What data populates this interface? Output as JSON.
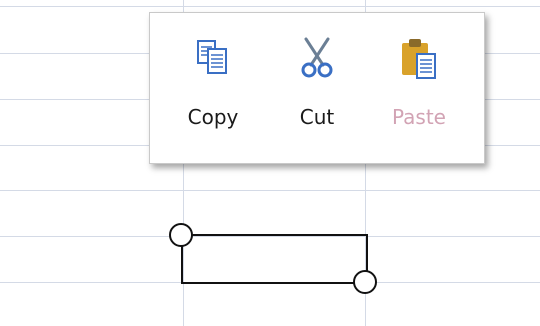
{
  "context_menu": {
    "items": [
      {
        "label": "Copy",
        "icon": "copy-icon",
        "enabled": true
      },
      {
        "label": "Cut",
        "icon": "scissors-icon",
        "enabled": true
      },
      {
        "label": "Paste",
        "icon": "clipboard-paste-icon",
        "enabled": false
      }
    ],
    "colors": {
      "disabled_text": "#d2a3b4",
      "icon_blue": "#3a6fc4",
      "clipboard_gold": "#d9a22a"
    }
  },
  "spreadsheet": {
    "gridline_color": "#d4dae6",
    "selection_color": "#111111"
  }
}
